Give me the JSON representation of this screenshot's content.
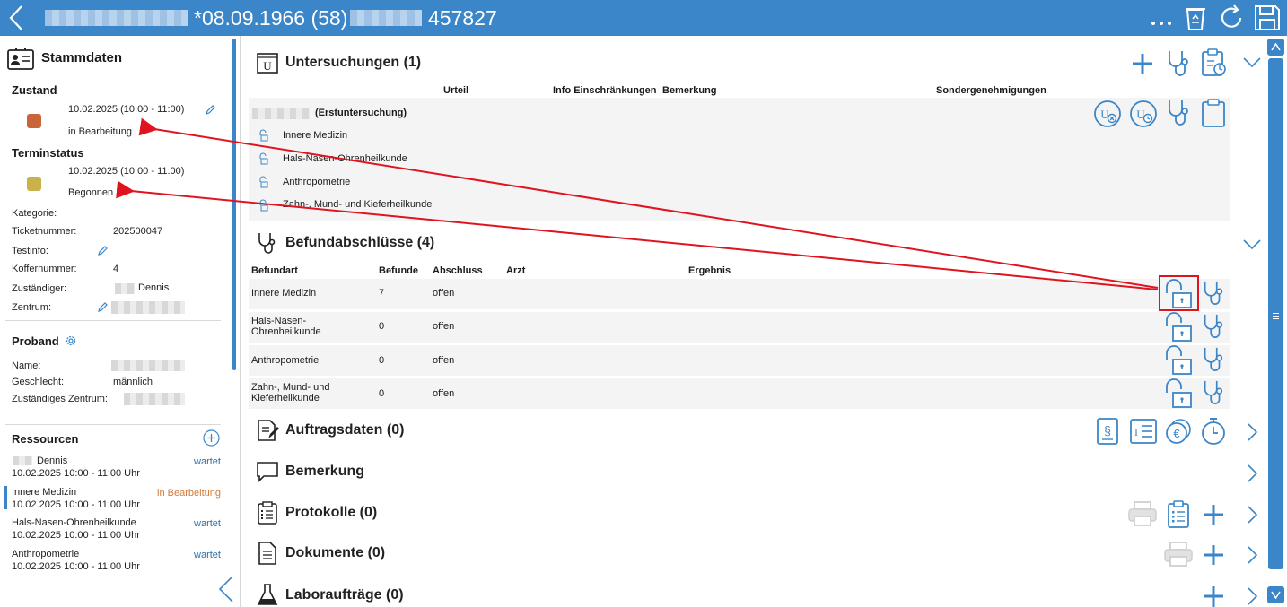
{
  "header": {
    "title_text": "*08.09.1966 (58)",
    "id_text": "457827"
  },
  "stammdaten": {
    "title": "Stammdaten",
    "zustand_label": "Zustand",
    "zustand_time": "10.02.2025 (10:00 - 11:00)",
    "zustand_value": "in Bearbeitung",
    "terminstatus_label": "Terminstatus",
    "terminstatus_time": "10.02.2025 (10:00 - 11:00)",
    "terminstatus_value": "Begonnen",
    "fields": {
      "kategorie": "Kategorie:",
      "ticketnummer": "Ticketnummer:",
      "ticketnummer_value": "202500047",
      "testinfo": "Testinfo:",
      "koffernummer": "Koffernummer:",
      "koffernummer_value": "4",
      "zustaendiger": "Zuständiger:",
      "zustaendiger_value": "Dennis",
      "zentrum": "Zentrum:"
    },
    "colors": {
      "zustand": "#c8663a",
      "terminstatus": "#c9b24a"
    }
  },
  "proband": {
    "title": "Proband",
    "name_label": "Name:",
    "geschlecht_label": "Geschlecht:",
    "geschlecht_value": "männlich",
    "zentrum_label": "Zuständiges Zentrum:"
  },
  "ressourcen": {
    "title": "Ressourcen",
    "items": [
      {
        "name": "Dennis",
        "time": "10.02.2025 10:00 - 11:00 Uhr",
        "status": "wartet"
      },
      {
        "name": "Innere Medizin",
        "time": "10.02.2025 10:00 - 11:00 Uhr",
        "status": "in Bearbeitung"
      },
      {
        "name": "Hals-Nasen-Ohrenheilkunde",
        "time": "10.02.2025 10:00 - 11:00 Uhr",
        "status": "wartet"
      },
      {
        "name": "Anthropometrie",
        "time": "10.02.2025 10:00 - 11:00 Uhr",
        "status": "wartet"
      }
    ]
  },
  "untersuchungen": {
    "title": "Untersuchungen (1)",
    "columns": [
      "Urteil",
      "Info Einschränkungen",
      "Bemerkung",
      "Sondergenehmigungen"
    ],
    "exam_label": "(Erstuntersuchung)",
    "items": [
      "Innere Medizin",
      "Hals-Nasen-Ohrenheilkunde",
      "Anthropometrie",
      "Zahn-, Mund- und Kieferheilkunde"
    ]
  },
  "befundabschluesse": {
    "title": "Befundabschlüsse (4)",
    "columns": [
      "Befundart",
      "Befunde",
      "Abschluss",
      "Arzt",
      "Ergebnis"
    ],
    "rows": [
      {
        "art1": "Innere Medizin",
        "art2": "",
        "befunde": "7",
        "abschluss": "offen"
      },
      {
        "art1": "Hals-Nasen-",
        "art2": "Ohrenheilkunde",
        "befunde": "0",
        "abschluss": "offen"
      },
      {
        "art1": "Anthropometrie",
        "art2": "",
        "befunde": "0",
        "abschluss": "offen"
      },
      {
        "art1": "Zahn-, Mund- und",
        "art2": "Kieferheilkunde",
        "befunde": "0",
        "abschluss": "offen"
      }
    ]
  },
  "sections": {
    "auftragsdaten": "Auftragsdaten (0)",
    "bemerkung": "Bemerkung",
    "protokolle": "Protokolle (0)",
    "dokumente": "Dokumente (0)",
    "laborauftraege": "Laboraufträge (0)"
  },
  "icons": {
    "accent": "#3a86c8",
    "annotation": "#e0141e"
  }
}
